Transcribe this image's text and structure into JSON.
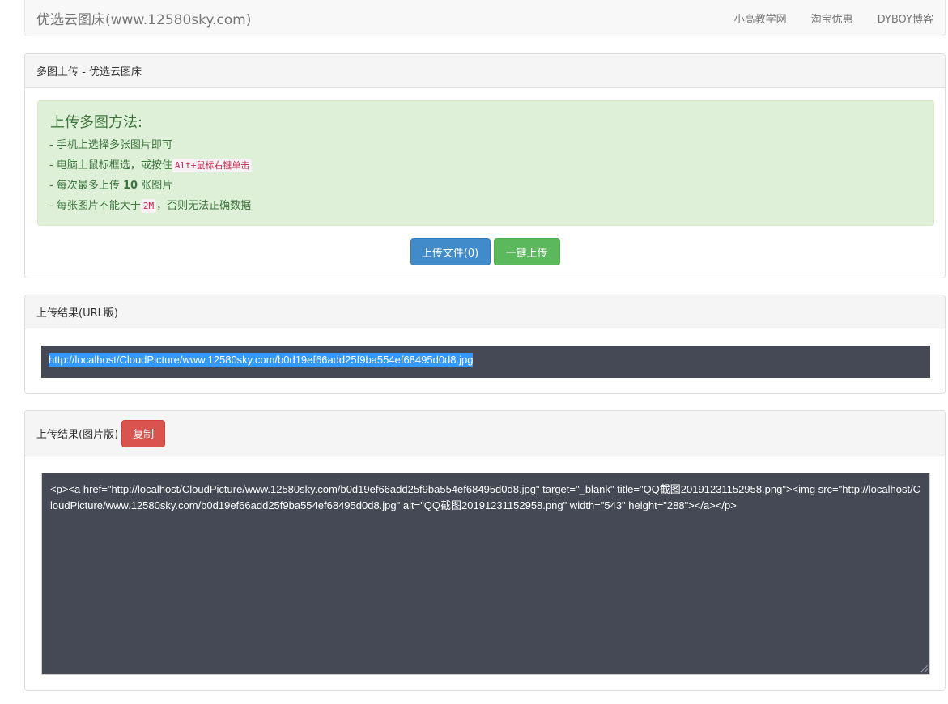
{
  "navbar": {
    "brand": "优选云图床(www.12580sky.com)",
    "links": [
      "小高教学网",
      "淘宝优惠",
      "DYBOY博客"
    ]
  },
  "upload_panel": {
    "heading": "多图上传 - 优选云图床",
    "method_title": "上传多图方法:",
    "tips": {
      "tip1": "- 手机上选择多张图片即可",
      "tip2_prefix": "- 电脑上鼠标框选，或按住",
      "tip2_code": "Alt+鼠标右键单击",
      "tip3_prefix": "- 每次最多上传 ",
      "tip3_bold": "10",
      "tip3_suffix": " 张图片",
      "tip4_prefix": "- 每张图片不能大于",
      "tip4_code": "2M",
      "tip4_suffix": "，否则无法正确数据"
    },
    "upload_file_label": "上传文件(0)",
    "one_click_label": "一键上传"
  },
  "url_panel": {
    "heading": "上传结果(URL版)",
    "url": "http://localhost/CloudPicture/www.12580sky.com/b0d19ef66add25f9ba554ef68495d0d8.jpg"
  },
  "image_panel": {
    "heading": "上传结果(图片版)",
    "copy_label": "复制",
    "html_code": "<p><a href=\"http://localhost/CloudPicture/www.12580sky.com/b0d19ef66add25f9ba554ef68495d0d8.jpg\" target=\"_blank\" title=\"QQ截图20191231152958.png\"><img src=\"http://localhost/CloudPicture/www.12580sky.com/b0d19ef66add25f9ba554ef68495d0d8.jpg\" alt=\"QQ截图20191231152958.png\" width=\"543\" height=\"288\"></a></p>"
  },
  "colors": {
    "primary": "#428bca",
    "success": "#5cb85c",
    "danger": "#d9534f",
    "alert_bg": "#dff0d8",
    "code_bg": "#454955"
  }
}
